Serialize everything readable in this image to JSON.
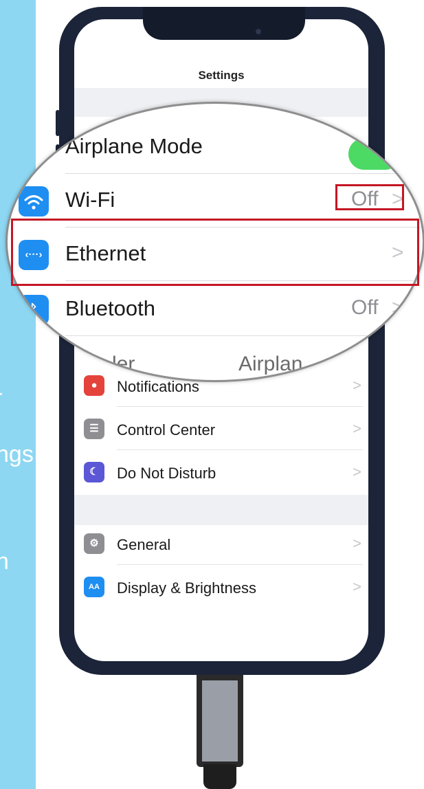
{
  "page": {
    "background_left_panel": "#8ed7f2",
    "left_text_fragments": [
      "r",
      "ngs",
      "n"
    ]
  },
  "settings": {
    "title": "Settings",
    "rows_small": [
      {
        "label": "Notifications",
        "icon": "notifications-icon",
        "icon_color": "#e4433b",
        "glyph": "●"
      },
      {
        "label": "Control Center",
        "icon": "control-center-icon",
        "icon_color": "#8e8e93",
        "glyph": "☰"
      },
      {
        "label": "Do Not Disturb",
        "icon": "moon-icon",
        "icon_color": "#5b57d6",
        "glyph": "☾"
      },
      {
        "label": "General",
        "icon": "gear-icon",
        "icon_color": "#8e8e93",
        "glyph": "⚙"
      },
      {
        "label": "Display & Brightness",
        "icon": "display-brightness-icon",
        "icon_color": "#1f8ef1",
        "glyph": "AA"
      }
    ],
    "chevron": ">"
  },
  "magnifier": {
    "rows": [
      {
        "label": "Airplane Mode",
        "value": "",
        "icon": "airplane-icon",
        "icon_color": "#f19a37"
      },
      {
        "label": "Wi-Fi",
        "value": "Off",
        "icon": "wifi-icon",
        "icon_color": "#1f8ef1"
      },
      {
        "label": "Ethernet",
        "value": "",
        "icon": "ethernet-icon",
        "icon_color": "#1f8ef1"
      },
      {
        "label": "Bluetooth",
        "value": "Off",
        "icon": "bluetooth-icon",
        "icon_color": "#1f8ef1"
      }
    ],
    "airplane_toggle_on": true,
    "peek_left": "ler",
    "peek_right": "Airplan",
    "highlight_color": "#c41624"
  }
}
